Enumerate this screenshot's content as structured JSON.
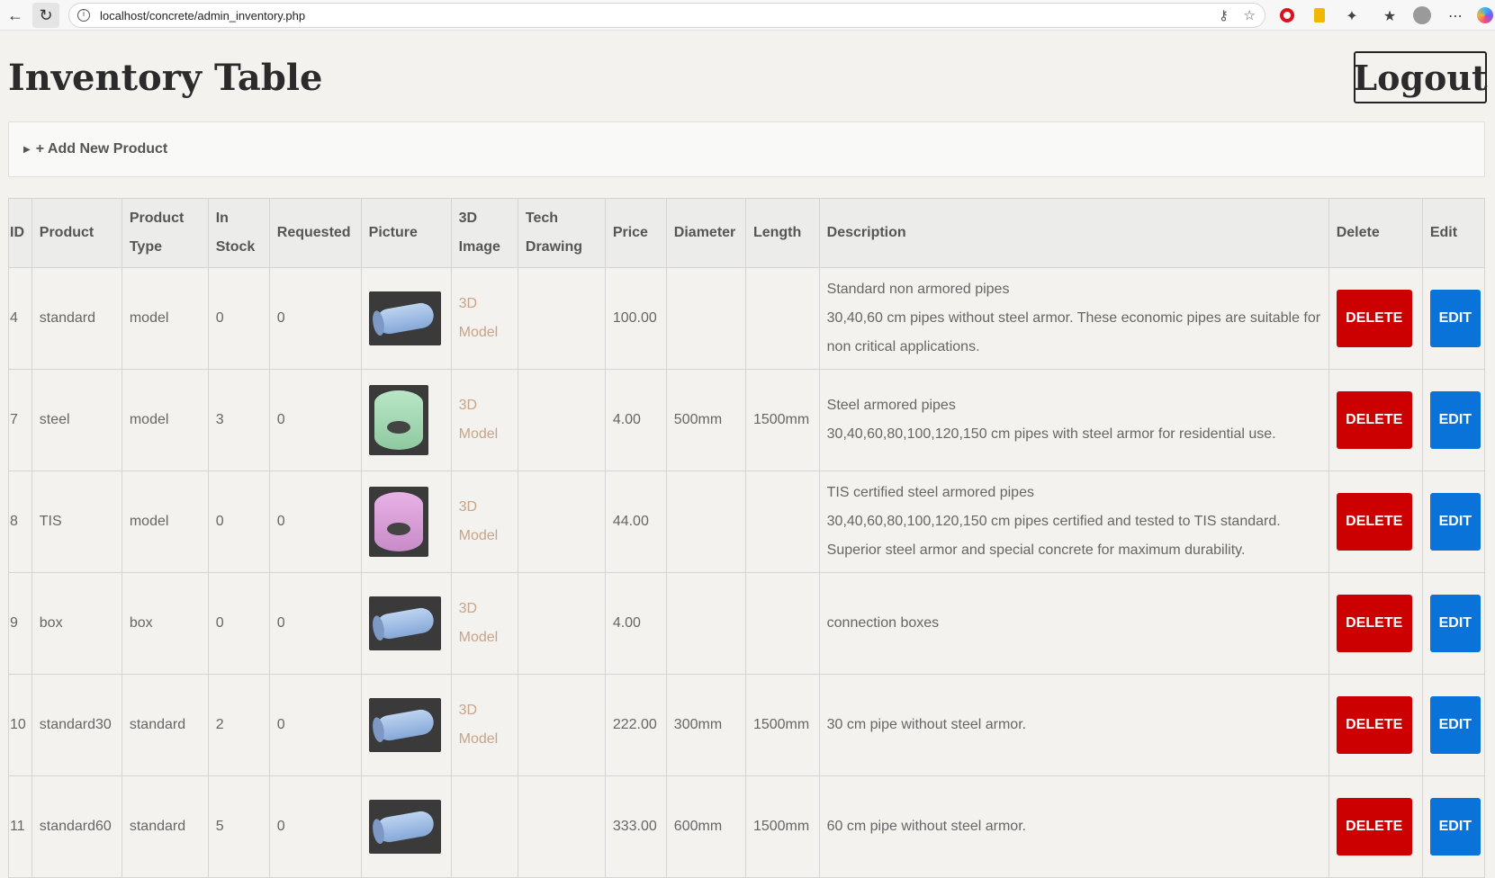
{
  "browser": {
    "url": "localhost/concrete/admin_inventory.php"
  },
  "page": {
    "title": "Inventory Table",
    "logout_label": "Logout",
    "add_product_label": "+ Add New Product"
  },
  "table": {
    "headers": {
      "id": "ID",
      "product": "Product",
      "product_type": "Product Type",
      "in_stock": "In Stock",
      "requested": "Requested",
      "picture": "Picture",
      "image_3d": "3D Image",
      "tech_drawing": "Tech Drawing",
      "price": "Price",
      "diameter": "Diameter",
      "length": "Length",
      "description": "Description",
      "delete": "Delete",
      "edit": "Edit"
    },
    "model_link_line1": "3D",
    "model_link_line2": "Model",
    "delete_label": "DELETE",
    "edit_label": "EDIT",
    "rows": [
      {
        "id": "4",
        "product": "standard",
        "type": "model",
        "in_stock": "0",
        "requested": "0",
        "picture": "blue-pipe",
        "model": true,
        "price": "100.00",
        "diameter": "",
        "length": "",
        "description": [
          "Standard non armored pipes",
          "30,40,60 cm pipes without steel armor. These economic pipes are suitable for",
          "non critical applications."
        ]
      },
      {
        "id": "7",
        "product": "steel",
        "type": "model",
        "in_stock": "3",
        "requested": "0",
        "picture": "green-cylinder",
        "model": true,
        "price": "4.00",
        "diameter": "500mm",
        "length": "1500mm",
        "description": [
          "Steel armored pipes",
          "30,40,60,80,100,120,150 cm pipes with steel armor for residential use."
        ]
      },
      {
        "id": "8",
        "product": "TIS",
        "type": "model",
        "in_stock": "0",
        "requested": "0",
        "picture": "pink-cylinder",
        "model": true,
        "price": "44.00",
        "diameter": "",
        "length": "",
        "description": [
          "TIS certified steel armored pipes",
          "30,40,60,80,100,120,150 cm pipes certified and tested to TIS standard.",
          "Superior steel armor and special concrete for maximum durability."
        ]
      },
      {
        "id": "9",
        "product": "box",
        "type": "box",
        "in_stock": "0",
        "requested": "0",
        "picture": "blue-pipe",
        "model": true,
        "price": "4.00",
        "diameter": "",
        "length": "",
        "description": [
          "connection boxes"
        ]
      },
      {
        "id": "10",
        "product": "standard30",
        "type": "standard",
        "in_stock": "2",
        "requested": "0",
        "picture": "blue-pipe",
        "model": true,
        "price": "222.00",
        "diameter": "300mm",
        "length": "1500mm",
        "description": [
          "30 cm pipe without steel armor."
        ]
      },
      {
        "id": "11",
        "product": "standard60",
        "type": "standard",
        "in_stock": "5",
        "requested": "0",
        "picture": "blue-pipe",
        "model": false,
        "price": "333.00",
        "diameter": "600mm",
        "length": "1500mm",
        "description": [
          "60 cm pipe without steel armor."
        ]
      }
    ]
  },
  "colors": {
    "delete": "#cc0000",
    "edit": "#0a73d9",
    "link": "#c7a48a",
    "background": "#f3f2ef"
  },
  "icons": {
    "back": "back-arrow-icon",
    "reload": "reload-icon",
    "info": "info-icon",
    "key": "key-icon",
    "star": "star-icon",
    "opera": "opera-icon",
    "bookmark": "bookmark-icon",
    "extensions": "puzzle-icon",
    "favorites": "favorites-icon",
    "profile": "avatar-icon",
    "menu": "more-icon",
    "copilot": "copilot-icon"
  }
}
